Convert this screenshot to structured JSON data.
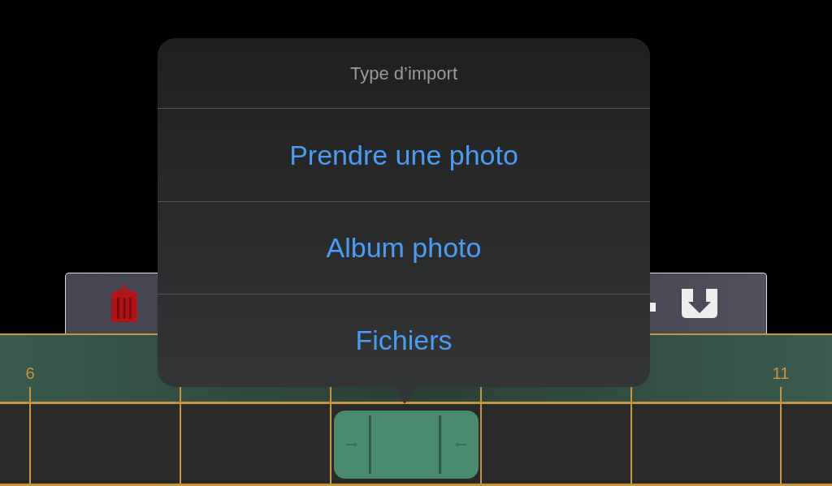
{
  "popover": {
    "title": "Type d’import",
    "options": [
      {
        "label": "Prendre une photo"
      },
      {
        "label": "Album photo"
      },
      {
        "label": "Fichiers"
      }
    ]
  },
  "ruler": {
    "markers": [
      "6",
      "11"
    ]
  }
}
